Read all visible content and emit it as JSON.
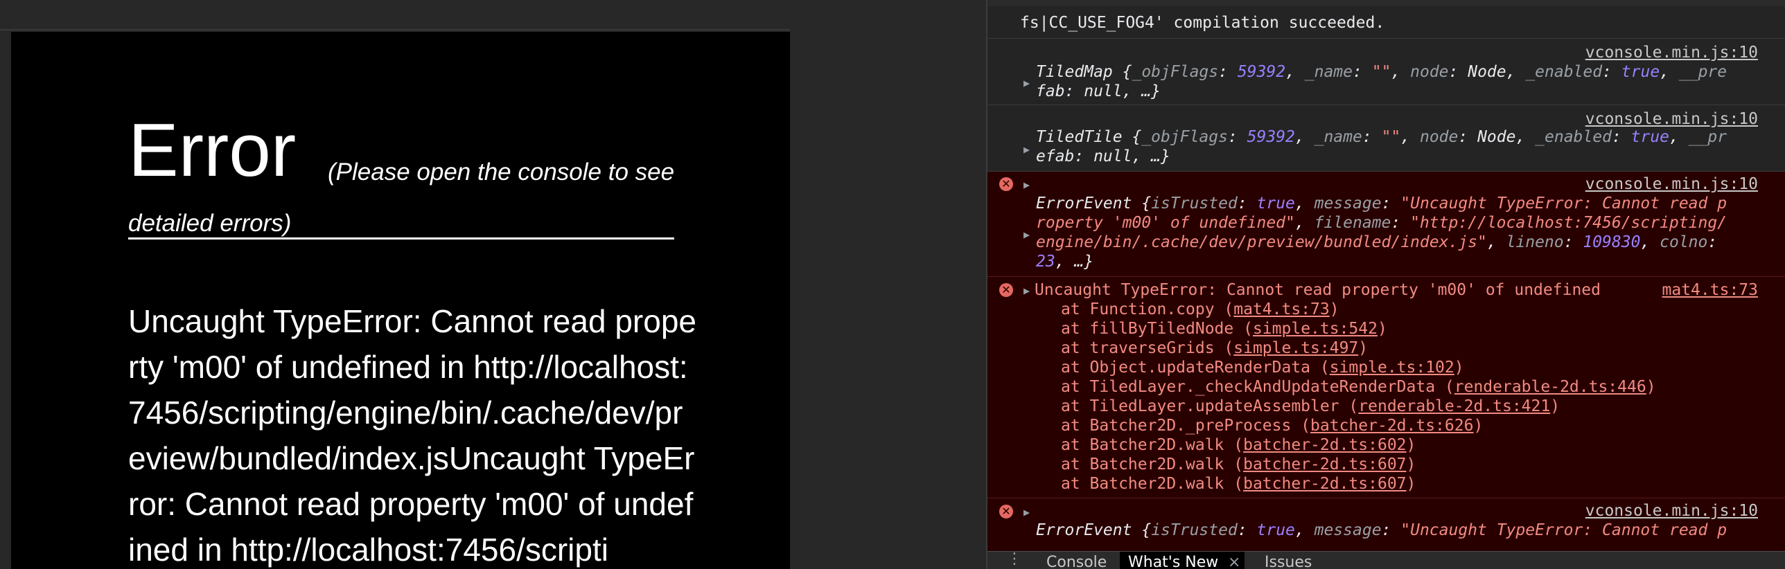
{
  "game_panel": {
    "title": "Error",
    "hint": "(Please open the console to see detailed errors)",
    "message": "Uncaught TypeError: Cannot read property 'm00' of undefined in http://localhost:7456/scripting/engine/bin/.cache/dev/preview/bundled/index.jsUncaught TypeError: Cannot read property 'm00' of undefined in http://localhost:7456/scripti"
  },
  "console": {
    "entries": [
      {
        "type": "log",
        "lines": [
          "fs|CC_USE_FOG4' compilation succeeded."
        ]
      },
      {
        "type": "log",
        "source": "vconsole.min.js:10",
        "object_name": "TiledMap",
        "objflags": "59392",
        "name_value": "\"\"",
        "node": "Node",
        "enabled": "true",
        "tail1": "__pre",
        "tail2": "fab: null, …}"
      },
      {
        "type": "log",
        "source": "vconsole.min.js:10",
        "object_name": "TiledTile",
        "objflags": "59392",
        "name_value": "\"\"",
        "node": "Node",
        "enabled": "true",
        "tail1": "__pr",
        "tail2": "efab: null, …}"
      },
      {
        "type": "error",
        "source": "vconsole.min.js:10",
        "object_name": "ErrorEvent",
        "is_trusted": "true",
        "message_part1": "\"Uncaught TypeError: Cannot read p",
        "message_part2": "roperty 'm00' of undefined\"",
        "filename_part1": "\"http://localhost:7456/scripting/",
        "filename_part2": "engine/bin/.cache/dev/preview/bundled/index.js\"",
        "lineno": "109830",
        "colno": "23",
        "tail": ", …}"
      },
      {
        "type": "error",
        "source": "mat4.ts:73",
        "message": "Uncaught TypeError: Cannot read property 'm00' of undefined",
        "stack": [
          {
            "fn": "at Function.copy",
            "loc": "mat4.ts:73"
          },
          {
            "fn": "at fillByTiledNode",
            "loc": "simple.ts:542"
          },
          {
            "fn": "at traverseGrids",
            "loc": "simple.ts:497"
          },
          {
            "fn": "at Object.updateRenderData",
            "loc": "simple.ts:102"
          },
          {
            "fn": "at TiledLayer._checkAndUpdateRenderData",
            "loc": "renderable-2d.ts:446"
          },
          {
            "fn": "at TiledLayer.updateAssembler",
            "loc": "renderable-2d.ts:421"
          },
          {
            "fn": "at Batcher2D._preProcess",
            "loc": "batcher-2d.ts:626"
          },
          {
            "fn": "at Batcher2D.walk",
            "loc": "batcher-2d.ts:602"
          },
          {
            "fn": "at Batcher2D.walk",
            "loc": "batcher-2d.ts:607"
          },
          {
            "fn": "at Batcher2D.walk",
            "loc": "batcher-2d.ts:607"
          }
        ]
      },
      {
        "type": "error",
        "source": "vconsole.min.js:10",
        "object_name": "ErrorEvent",
        "is_trusted": "true",
        "message_part1": "\"Uncaught TypeError: Cannot read p"
      }
    ]
  },
  "drawer": {
    "menu_icon": "vertical-dots-icon",
    "tabs": [
      {
        "label": "Console",
        "active": false
      },
      {
        "label": "What's New",
        "active": true,
        "closable": true
      },
      {
        "label": "Issues",
        "active": false
      }
    ],
    "close_glyph": "×"
  },
  "colors": {
    "error_bg": "#290000",
    "error_text": "#f28b82",
    "number": "#9980ff",
    "panel_bg": "#242424"
  }
}
